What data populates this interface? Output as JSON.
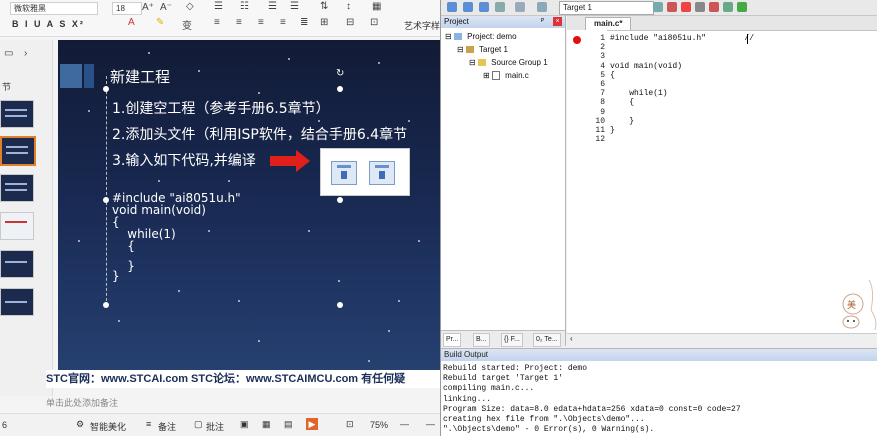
{
  "ppt": {
    "ribbon": {
      "font_name": "微软雅黑",
      "font_size": "18",
      "row2_left": "B  I  U  A  S  X²",
      "art_label": "艺术字样"
    },
    "left_panel": {
      "label": "节"
    },
    "slide": {
      "title": "新建工程",
      "steps": [
        "1.创建空工程（参考手册6.5章节）",
        "2.添加头文件（利用ISP软件，结合手册6.4章节",
        "3.输入如下代码,并编译"
      ],
      "code_lines": [
        "#include \"ai8051u.h\"",
        "void main(void)",
        "{",
        "    while(1)",
        "    {",
        "",
        "    }",
        "}"
      ]
    },
    "footer": "STC官网：www.STCAI.com      STC论坛：www.STCAIMCU.com      有任何疑",
    "notes_placeholder": "单击此处添加备注",
    "status": {
      "page": "6",
      "smart": "智能美化",
      "notes": "备注",
      "comment": "批注",
      "zoom": "75%"
    }
  },
  "keil": {
    "target": "Target 1",
    "project_panel": {
      "title": "Project",
      "tree": [
        "Project: demo",
        "Target 1",
        "Source Group 1",
        "main.c"
      ],
      "tabs": [
        "Pr...",
        "B...",
        "{} F...",
        "0₂ Te..."
      ]
    },
    "editor": {
      "tab": "main.c*",
      "line_numbers": [
        "1",
        "2",
        "3",
        "4",
        "5",
        "6",
        "7",
        "8",
        "9",
        "10",
        "11",
        "12"
      ],
      "code": [
        "#include \"ai8051u.h\"        //",
        "",
        "",
        "void main(void)",
        "{",
        "",
        "    while(1)",
        "    {",
        "",
        "    }",
        "}",
        ""
      ]
    },
    "build": {
      "title": "Build Output",
      "lines": [
        "Rebuild started: Project: demo",
        "Rebuild target 'Target 1'",
        "compiling main.c...",
        "linking...",
        "Program Size: data=8.0 edata+hdata=256 xdata=0 const=0 code=27",
        "creating hex file from \".\\Objects\\demo\"...",
        "\".\\Objects\\demo\" - 0 Error(s), 0 Warning(s)."
      ]
    }
  },
  "colors": {
    "slide_bg": "#182850",
    "accent_blue": "#3e6aa0",
    "arrow_red": "#e0201a",
    "keil_panel_head": "#c3d3ec",
    "breakpoint_red": "#e01010"
  }
}
